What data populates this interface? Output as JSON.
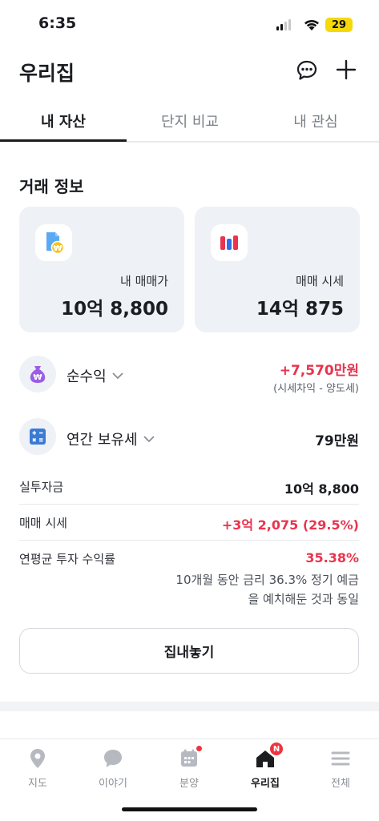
{
  "status_bar": {
    "time": "6:35",
    "battery": "29"
  },
  "header": {
    "title": "우리집"
  },
  "tabs": [
    {
      "label": "내 자산"
    },
    {
      "label": "단지 비교"
    },
    {
      "label": "내 관심"
    }
  ],
  "trade_info": {
    "title": "거래 정보",
    "cards": [
      {
        "label": "내 매매가",
        "value": "10억 8,800"
      },
      {
        "label": "매매 시세",
        "value": "14억 875"
      }
    ]
  },
  "net_profit": {
    "label": "순수익",
    "value": "+7,570만원",
    "note": "(시세차익 - 양도세)"
  },
  "annual_tax": {
    "label": "연간 보유세",
    "value": "79만원"
  },
  "details": [
    {
      "label": "실투자금",
      "value": "10억 8,800"
    },
    {
      "label": "매매 시세",
      "value": "+3억 2,075 (29.5%)"
    },
    {
      "label": "연평균 투자 수익률",
      "value": "35.38%"
    }
  ],
  "description": {
    "line1": "10개월 동안 금리 36.3% 정기 예금",
    "line2": "을 예치해둔 것과 동일"
  },
  "cta": {
    "label": "집내놓기"
  },
  "bottom_nav": [
    {
      "label": "지도"
    },
    {
      "label": "이야기"
    },
    {
      "label": "분양"
    },
    {
      "label": "우리집",
      "badge": "N"
    },
    {
      "label": "전체"
    }
  ],
  "colors": {
    "accent_red": "#e8344e",
    "card_bg": "#eef1f6",
    "text": "#1b1d21"
  }
}
